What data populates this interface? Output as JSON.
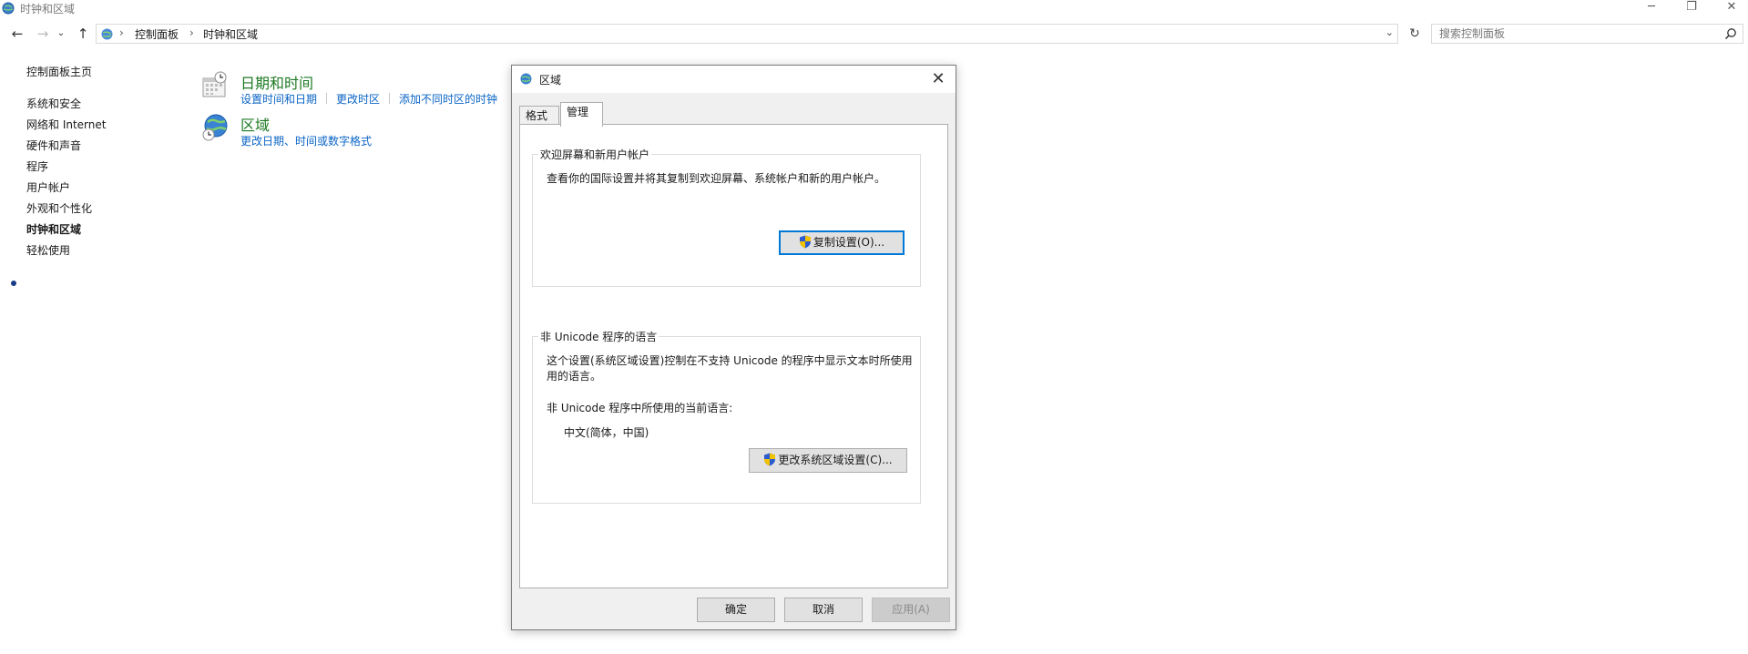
{
  "window": {
    "title": "时钟和区域",
    "controls": {
      "minimize": "─",
      "maximize": "❐",
      "close": "✕"
    }
  },
  "addressbar": {
    "back": "←",
    "forward": "→",
    "recent": "⌄",
    "up": "↑",
    "breadcrumbs": [
      "控制面板",
      "时钟和区域"
    ],
    "separator": "›",
    "dropdown": "⌄",
    "refresh": "↻"
  },
  "search": {
    "placeholder": "搜索控制面板"
  },
  "leftnav": {
    "home": "控制面板主页",
    "items": [
      "系统和安全",
      "网络和 Internet",
      "硬件和声音",
      "程序",
      "用户帐户",
      "外观和个性化",
      "时钟和区域",
      "轻松使用"
    ],
    "current_index": 6
  },
  "categories": [
    {
      "title": "日期和时间",
      "links": [
        "设置时间和日期",
        "更改时区",
        "添加不同时区的时钟"
      ],
      "icon": "calendar-clock-icon"
    },
    {
      "title": "区域",
      "links": [
        "更改日期、时间或数字格式"
      ],
      "icon": "globe-clock-icon"
    }
  ],
  "dialog": {
    "title": "区域",
    "close": "✕",
    "tabs": [
      "格式",
      "管理"
    ],
    "active_tab": 1,
    "group1": {
      "title": "欢迎屏幕和新用户帐户",
      "text": "查看你的国际设置并将其复制到欢迎屏幕、系统帐户和新的用户帐户。",
      "button": "复制设置(O)..."
    },
    "group2": {
      "title": "非 Unicode 程序的语言",
      "text_line1": "这个设置(系统区域设置)控制在不支持 Unicode 的程序中显示文本时所使用",
      "text_line2": "用的语言。",
      "current_label": "非 Unicode 程序中所使用的当前语言:",
      "current_value": "中文(简体，中国)",
      "button": "更改系统区域设置(C)..."
    },
    "buttons": {
      "ok": "确定",
      "cancel": "取消",
      "apply": "应用(A)"
    }
  },
  "colors": {
    "link": "#0a64c6",
    "category_title": "#1e7a24",
    "focus": "#0078d7"
  }
}
